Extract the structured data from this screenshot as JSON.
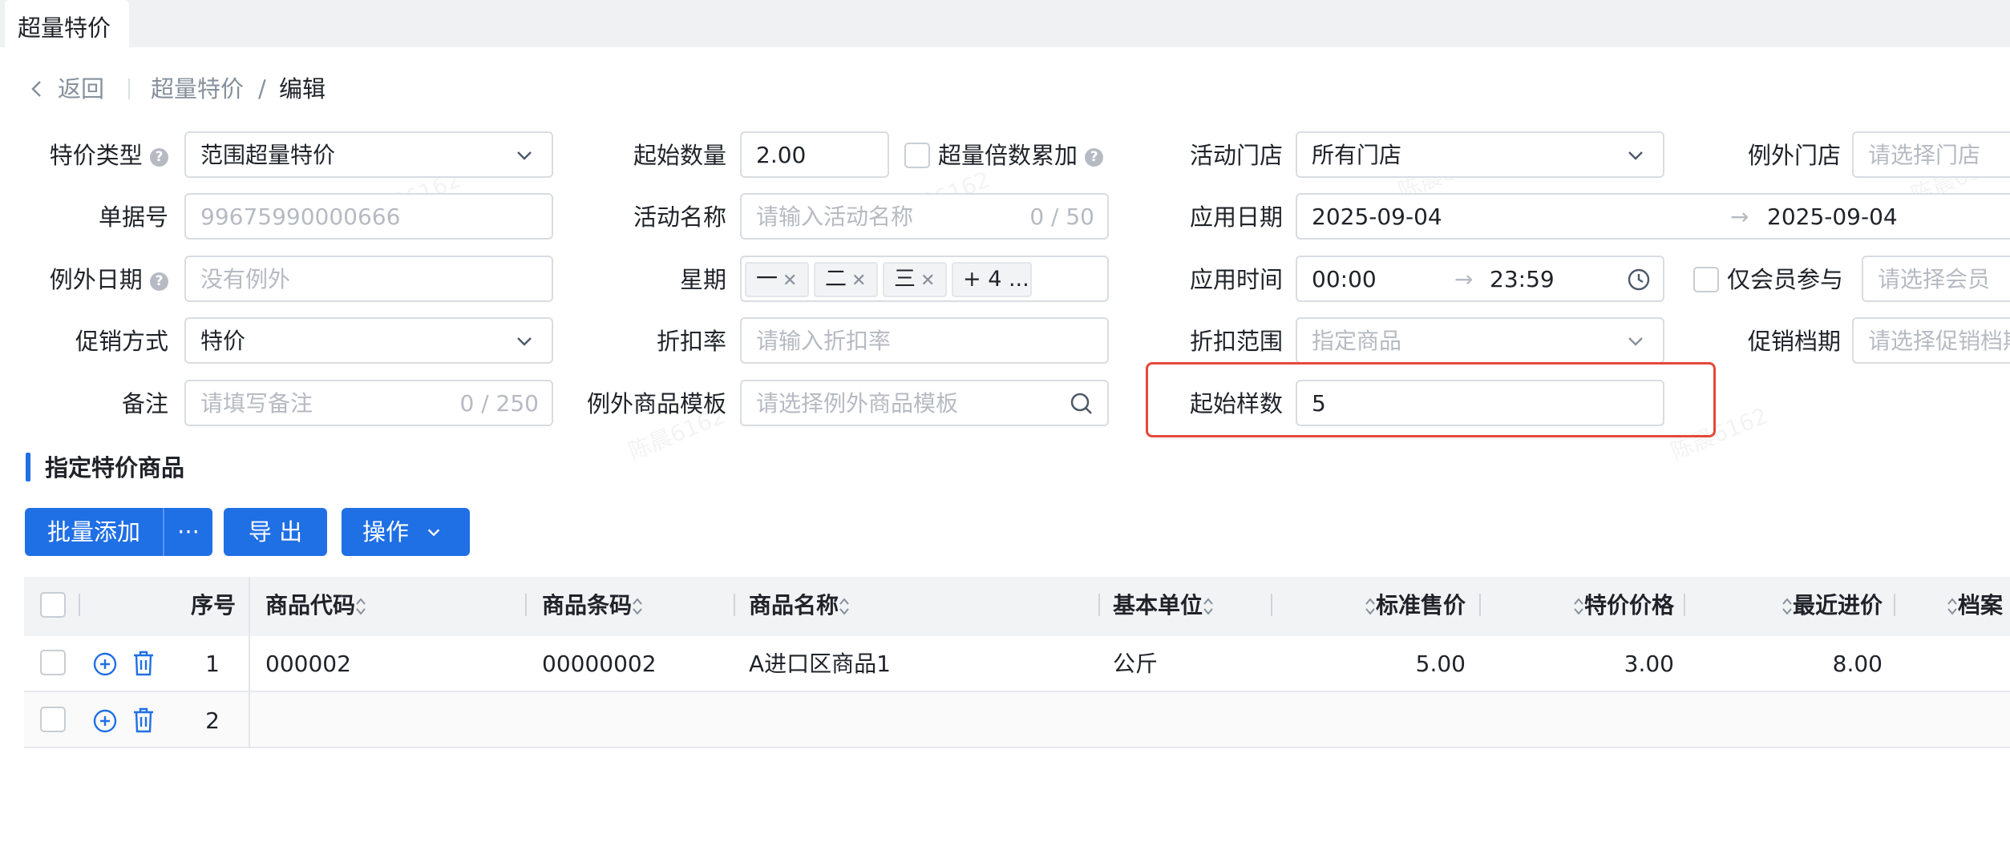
{
  "tab": {
    "label": "超量特价"
  },
  "breadcrumb": {
    "back": "返回",
    "parent": "超量特价",
    "sep": "/",
    "current": "编辑"
  },
  "form": {
    "col1": {
      "special_type": {
        "label": "特价类型",
        "value": "范围超量特价"
      },
      "doc_no": {
        "label": "单据号",
        "value": "99675990000666"
      },
      "except_date": {
        "label": "例外日期",
        "placeholder": "没有例外"
      },
      "promo_method": {
        "label": "促销方式",
        "value": "特价"
      },
      "remark": {
        "label": "备注",
        "placeholder": "请填写备注",
        "counter": "0 / 250"
      }
    },
    "col2": {
      "start_qty": {
        "label": "起始数量",
        "value": "2.00"
      },
      "multiple_accum": {
        "label": "超量倍数累加",
        "checked": false
      },
      "activity_name": {
        "label": "活动名称",
        "placeholder": "请输入活动名称",
        "counter": "0 / 50"
      },
      "weekday": {
        "label": "星期",
        "tags": [
          "一",
          "二",
          "三"
        ],
        "more": "+ 4 ..."
      },
      "discount_rate": {
        "label": "折扣率",
        "placeholder": "请输入折扣率"
      },
      "except_template": {
        "label": "例外商品模板",
        "placeholder": "请选择例外商品模板"
      }
    },
    "col3": {
      "store": {
        "label": "活动门店",
        "value": "所有门店"
      },
      "apply_date": {
        "label": "应用日期",
        "start": "2025-09-04",
        "end": "2025-09-04"
      },
      "apply_time": {
        "label": "应用时间",
        "start": "00:00",
        "end": "23:59"
      },
      "discount_scope": {
        "label": "折扣范围",
        "value": "指定商品"
      },
      "start_sample": {
        "label": "起始样数",
        "value": "5"
      }
    },
    "col4": {
      "except_store": {
        "label": "例外门店",
        "placeholder": "请选择门店"
      },
      "member_only": {
        "label": "仅会员参与",
        "checked": false,
        "placeholder": "请选择会员"
      },
      "promo_period": {
        "label": "促销档期",
        "placeholder": "请选择促销档期"
      }
    }
  },
  "section": {
    "title": "指定特价商品"
  },
  "toolbar": {
    "batch_add": "批量添加",
    "more": "···",
    "export": "导 出",
    "operate": "操作"
  },
  "table": {
    "headers": {
      "seq": "序号",
      "code": "商品代码",
      "barcode": "商品条码",
      "name": "商品名称",
      "unit": "基本单位",
      "std_price": "标准售价",
      "special_price": "特价价格",
      "last_cost": "最近进价",
      "archive": "档案"
    },
    "rows": [
      {
        "seq": "1",
        "code": "000002",
        "barcode": "00000002",
        "name": "A进口区商品1",
        "unit": "公斤",
        "std_price": "5.00",
        "special_price": "3.00",
        "last_cost": "8.00"
      },
      {
        "seq": "2",
        "code": "",
        "barcode": "",
        "name": "",
        "unit": "",
        "std_price": "",
        "special_price": "",
        "last_cost": ""
      }
    ]
  },
  "watermark": "陈晨6162",
  "colors": {
    "primary": "#1f6fe5",
    "highlight": "#e5493a"
  }
}
